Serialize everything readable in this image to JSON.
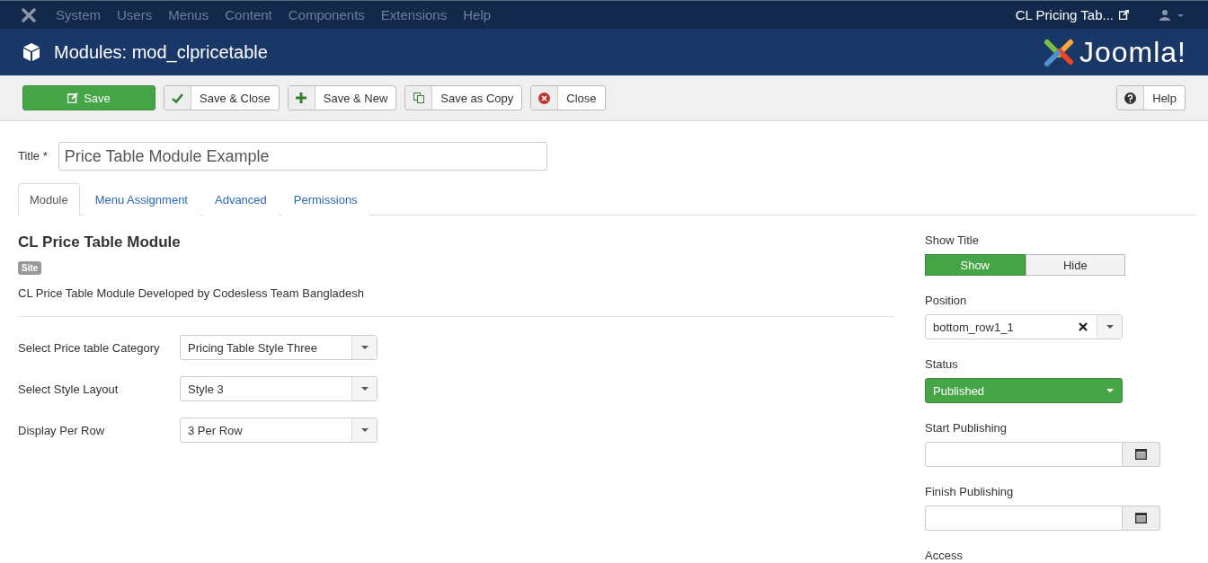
{
  "top_menu": {
    "items": [
      "System",
      "Users",
      "Menus",
      "Content",
      "Components",
      "Extensions",
      "Help"
    ],
    "site_link": "CL Pricing Tab..."
  },
  "header": {
    "title": "Modules: mod_clpricetable",
    "logo_text": "Joomla!"
  },
  "toolbar": {
    "buttons": [
      {
        "label": "Save",
        "kind": "primary"
      },
      {
        "label": "Save & Close",
        "kind": "default"
      },
      {
        "label": "Save & New",
        "kind": "default"
      },
      {
        "label": "Save as Copy",
        "kind": "default"
      },
      {
        "label": "Close",
        "kind": "default"
      }
    ],
    "help": "Help"
  },
  "title_field": {
    "label": "Title *",
    "value": "Price Table Module Example"
  },
  "tabs": [
    {
      "label": "Module",
      "selected": true
    },
    {
      "label": "Menu Assignment",
      "selected": false
    },
    {
      "label": "Advanced",
      "selected": false
    },
    {
      "label": "Permissions",
      "selected": false
    }
  ],
  "module": {
    "name": "CL Price Table Module",
    "badge": "Site",
    "description": "CL Price Table Module Developed by Codesless Team Bangladesh"
  },
  "fields": [
    {
      "label": "Select Price table Category",
      "value": "Pricing Table Style Three"
    },
    {
      "label": "Select Style Layout",
      "value": "Style 3"
    },
    {
      "label": "Display Per Row",
      "value": "3 Per Row"
    }
  ],
  "sidebar": {
    "show_title": {
      "label": "Show Title",
      "options": [
        {
          "label": "Show",
          "selected": true
        },
        {
          "label": "Hide",
          "selected": false
        }
      ]
    },
    "position": {
      "label": "Position",
      "value": "bottom_row1_1"
    },
    "status": {
      "label": "Status",
      "value": "Published"
    },
    "start_publishing": {
      "label": "Start Publishing"
    },
    "finish_publishing": {
      "label": "Finish Publishing"
    },
    "access": {
      "label": "Access"
    }
  }
}
